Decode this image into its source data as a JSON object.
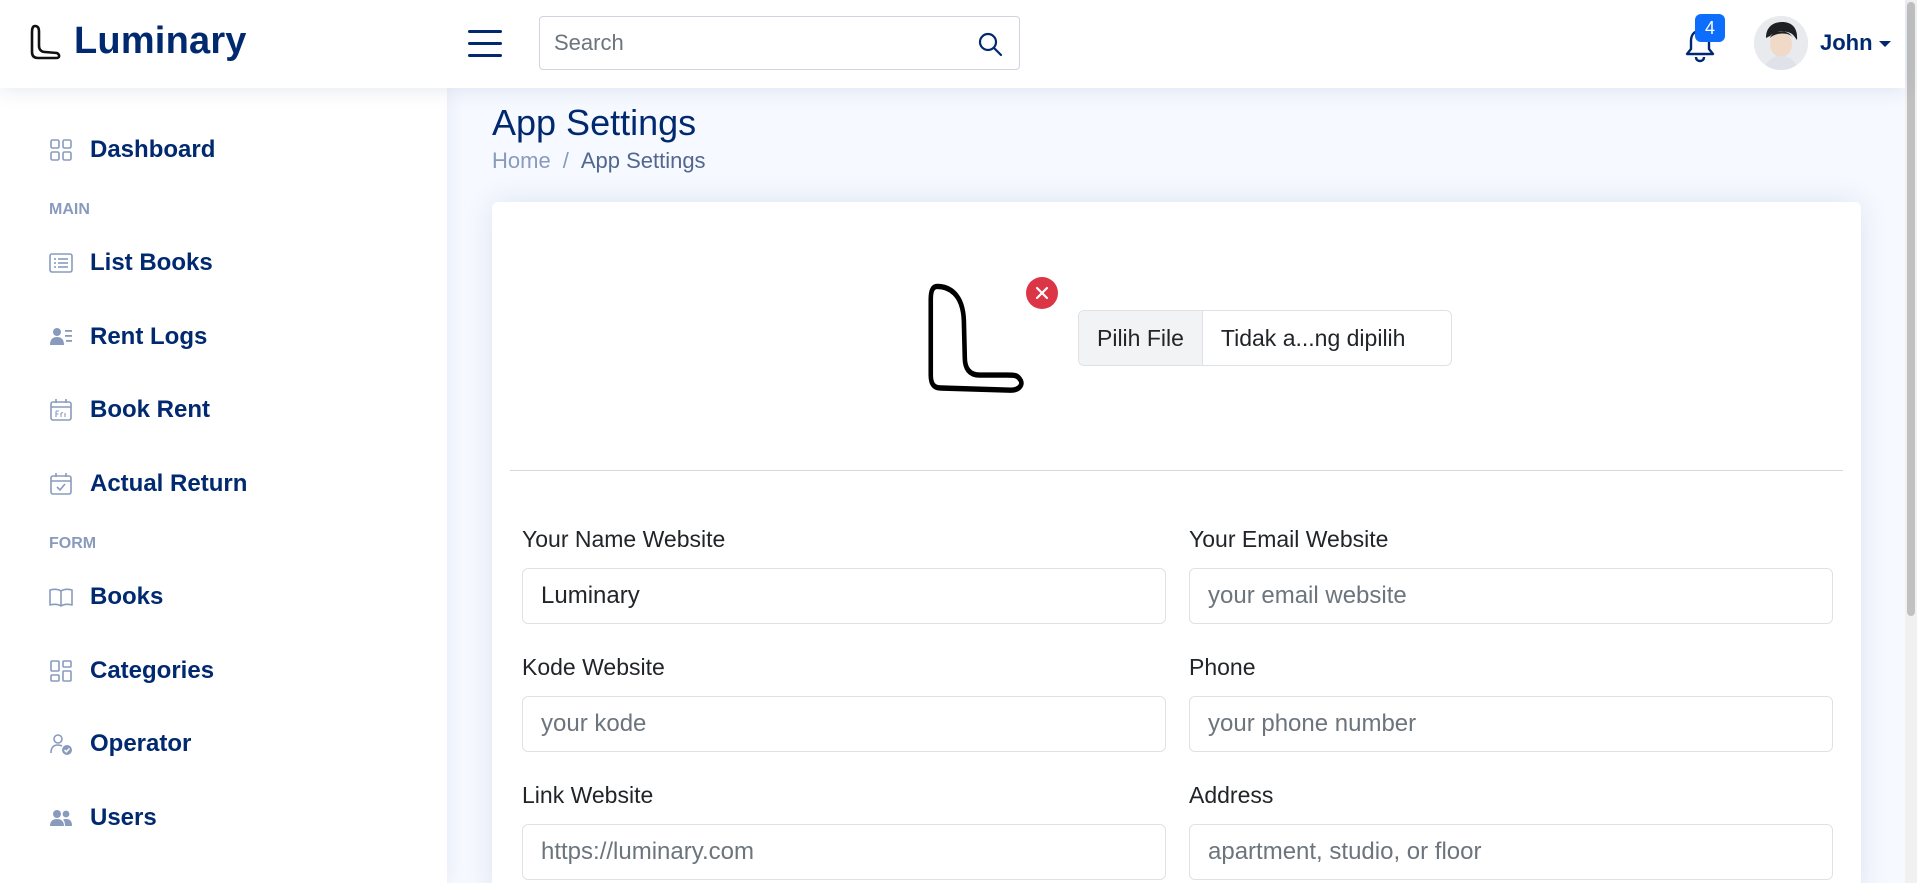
{
  "header": {
    "brand": "Luminary",
    "search_placeholder": "Search",
    "notification_count": "4",
    "user_name": "John"
  },
  "sidebar": {
    "dashboard": "Dashboard",
    "heading_main": "MAIN",
    "list_books": "List Books",
    "rent_logs": "Rent Logs",
    "book_rent": "Book Rent",
    "actual_return": "Actual Return",
    "heading_form": "FORM",
    "books": "Books",
    "categories": "Categories",
    "operator": "Operator",
    "users": "Users"
  },
  "page": {
    "title": "App Settings",
    "breadcrumb_home": "Home",
    "breadcrumb_sep": "/",
    "breadcrumb_current": "App Settings"
  },
  "form": {
    "file_button": "Pilih File",
    "file_status": "Tidak a...ng dipilih",
    "name_label": "Your Name Website",
    "name_value": "Luminary",
    "email_label": "Your Email Website",
    "email_placeholder": "your email website",
    "kode_label": "Kode Website",
    "kode_placeholder": "your kode",
    "phone_label": "Phone",
    "phone_placeholder": "your phone number",
    "link_label": "Link Website",
    "link_placeholder": "https://luminary.com",
    "address_label": "Address",
    "address_placeholder": "apartment, studio, or floor"
  },
  "colors": {
    "brand": "#012970",
    "muted": "#899bbd",
    "badge": "#0d6efd",
    "danger": "#dc3545",
    "background": "#f6f9ff"
  }
}
